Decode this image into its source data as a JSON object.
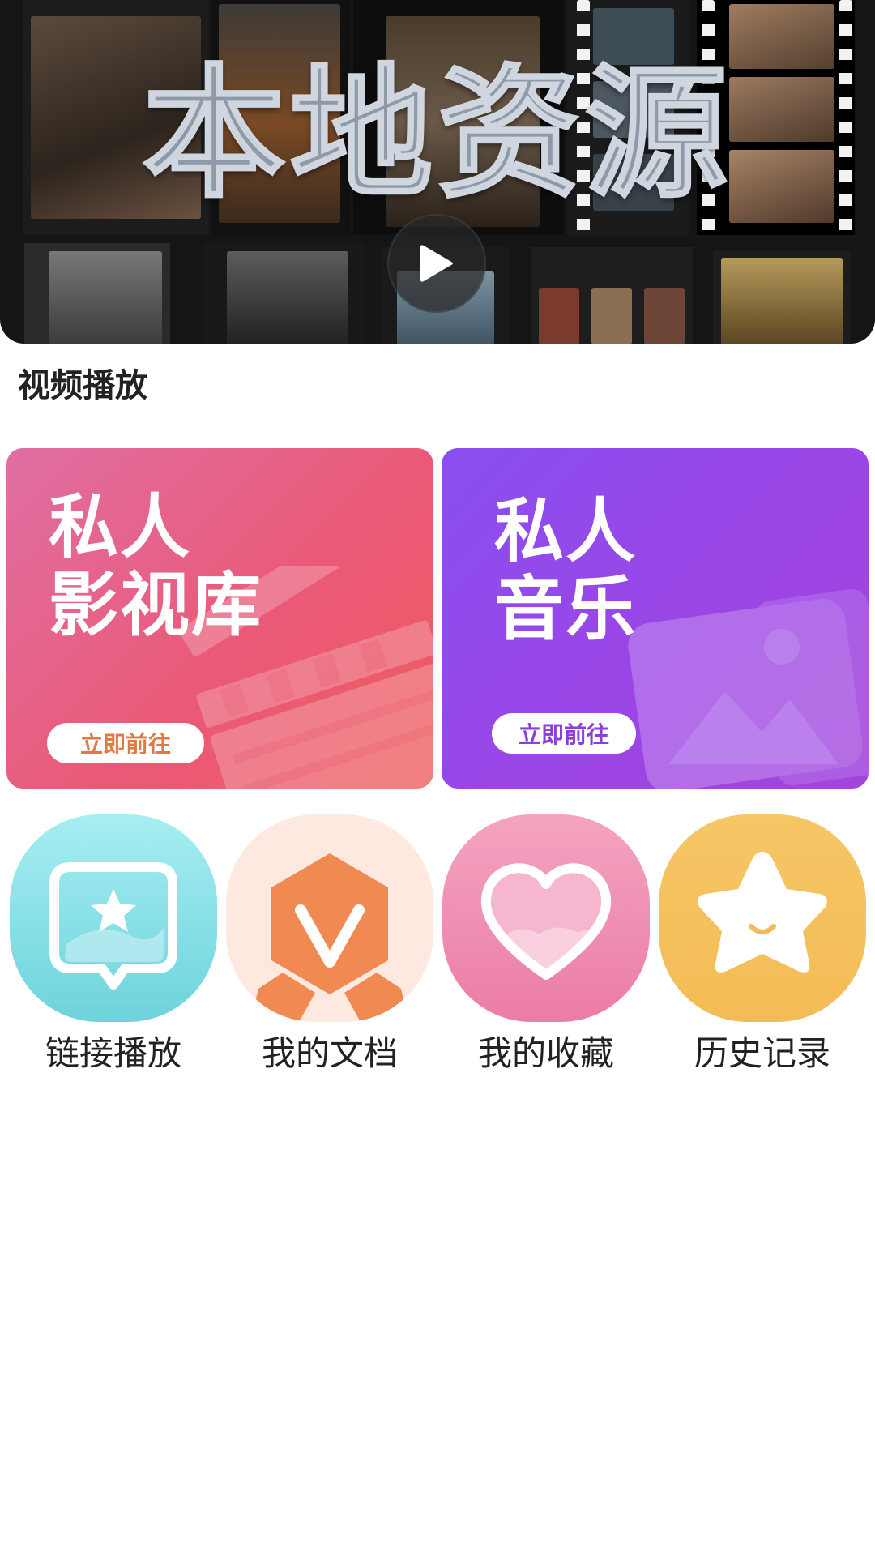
{
  "banner": {
    "title": "本地资源",
    "play_icon": "play-icon"
  },
  "section": {
    "video_play": "视频播放"
  },
  "cards": {
    "movie": {
      "title_line1": "私人",
      "title_line2": "影视库",
      "button": "立即前往",
      "color_start": "#e06fa3",
      "color_end": "#ee5c5c",
      "button_text_color": "#e07a45"
    },
    "music": {
      "title_line1": "私人",
      "title_line2": "音乐",
      "button": "立即前往",
      "color_start": "#8a4ff0",
      "color_end": "#a145dc",
      "button_text_color": "#8a3fd8"
    }
  },
  "quick": [
    {
      "label": "链接播放",
      "icon": "link-play-icon",
      "color": "#7fdde3"
    },
    {
      "label": "我的文档",
      "icon": "document-icon",
      "color": "#f08a52"
    },
    {
      "label": "我的收藏",
      "icon": "heart-icon",
      "color": "#ef86ad"
    },
    {
      "label": "历史记录",
      "icon": "star-icon",
      "color": "#f5c15d"
    }
  ]
}
